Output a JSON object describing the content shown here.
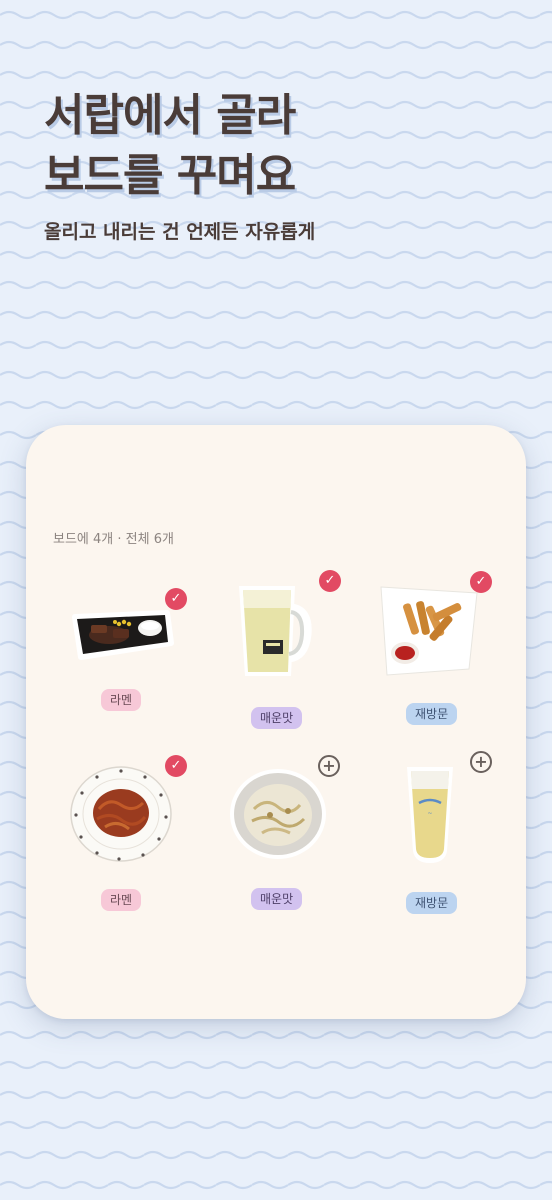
{
  "headline": {
    "line1": "서랍에서 골라",
    "line2": "보드를 꾸며요"
  },
  "subtitle": "올리고 내리는 건 언제든 자유롭게",
  "board": {
    "count_text": "보드에 4개 · 전체 6개",
    "items": [
      {
        "food": "steak-plate",
        "tag": "라멘",
        "tag_color": "pink",
        "selected": true
      },
      {
        "food": "beer-mug",
        "tag": "매운맛",
        "tag_color": "purple",
        "selected": true
      },
      {
        "food": "spring-rolls",
        "tag": "재방문",
        "tag_color": "blue",
        "selected": true
      },
      {
        "food": "pasta-plate",
        "tag": "라멘",
        "tag_color": "pink",
        "selected": true
      },
      {
        "food": "noodle-bowl",
        "tag": "매운맛",
        "tag_color": "purple",
        "selected": false
      },
      {
        "food": "beer-glass",
        "tag": "재방문",
        "tag_color": "blue",
        "selected": false
      }
    ]
  },
  "icons": {
    "selected": "check-icon",
    "add": "plus-icon"
  },
  "colors": {
    "background": "#e9f0fa",
    "headline": "#4a3c38",
    "board": "#fcf6ef",
    "check": "#e24a63"
  }
}
